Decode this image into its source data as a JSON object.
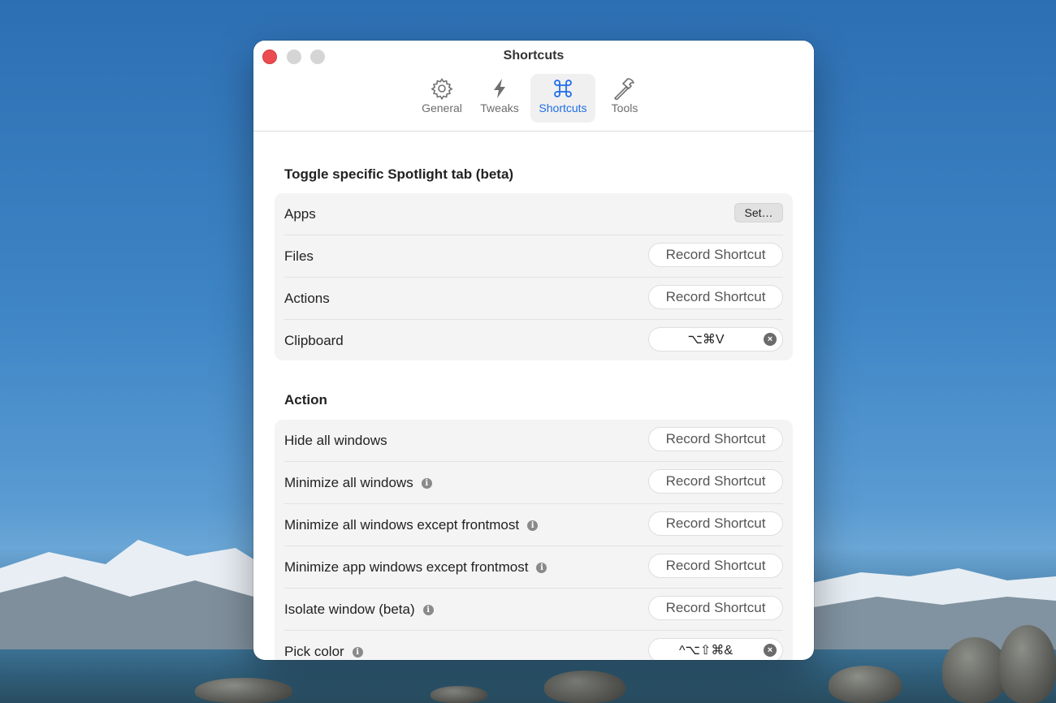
{
  "window": {
    "title": "Shortcuts"
  },
  "toolbar": {
    "tabs": [
      {
        "label": "General",
        "icon": "gear-icon"
      },
      {
        "label": "Tweaks",
        "icon": "bolt-icon"
      },
      {
        "label": "Shortcuts",
        "icon": "command-icon",
        "active": true
      },
      {
        "label": "Tools",
        "icon": "hammer-icon"
      }
    ]
  },
  "colors": {
    "accent": "#1f6ee8",
    "close": "#ec4b4f"
  },
  "spotlight": {
    "heading": "Toggle specific Spotlight tab (beta)",
    "rows": [
      {
        "label": "Apps",
        "control": "Set…"
      },
      {
        "label": "Files",
        "control": "Record Shortcut"
      },
      {
        "label": "Actions",
        "control": "Record Shortcut"
      },
      {
        "label": "Clipboard",
        "shortcut": "⌥⌘V"
      }
    ]
  },
  "action": {
    "heading": "Action",
    "rows": [
      {
        "label": "Hide all windows",
        "control": "Record Shortcut",
        "info": false
      },
      {
        "label": "Minimize all windows",
        "control": "Record Shortcut",
        "info": true
      },
      {
        "label": "Minimize all windows except frontmost",
        "control": "Record Shortcut",
        "info": true
      },
      {
        "label": "Minimize app windows except frontmost",
        "control": "Record Shortcut",
        "info": true
      },
      {
        "label": "Isolate window (beta)",
        "control": "Record Shortcut",
        "info": true
      },
      {
        "label": "Pick color",
        "shortcut": "^⌥⇧⌘&",
        "info": true
      }
    ]
  }
}
